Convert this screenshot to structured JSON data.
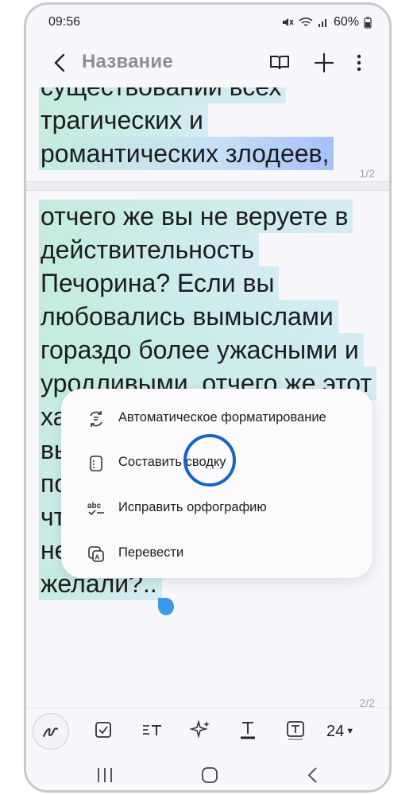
{
  "status": {
    "time": "09:56",
    "battery": "60%"
  },
  "appbar": {
    "title": "Название"
  },
  "page1": {
    "lines": [
      "существовании всех",
      "трагических и",
      "романтических злодеев,"
    ],
    "page_number": "1/2"
  },
  "page2": {
    "lines": [
      "отчего же вы не веруете в",
      "действительность",
      "Печорина? Если вы",
      "любовались вымыслами",
      "гораздо более ужасными и",
      "уродливыми, отчего же этот",
      "ха",
      "вы",
      "по",
      "чт",
      "не",
      "желали?.."
    ],
    "page_number": "2/2"
  },
  "menu": {
    "items": [
      {
        "label": "Автоматическое форматирование",
        "icon": "auto-format-icon"
      },
      {
        "label": "Составить сводку",
        "icon": "summary-icon"
      },
      {
        "label": "Исправить орфографию",
        "icon": "spellcheck-icon"
      },
      {
        "label": "Перевести",
        "icon": "translate-icon"
      }
    ]
  },
  "toolbar": {
    "font_size": "24"
  },
  "colors": {
    "selection_green": "#b2e8d4",
    "selection_blue": "#a0befa",
    "accent": "#1565c8"
  }
}
